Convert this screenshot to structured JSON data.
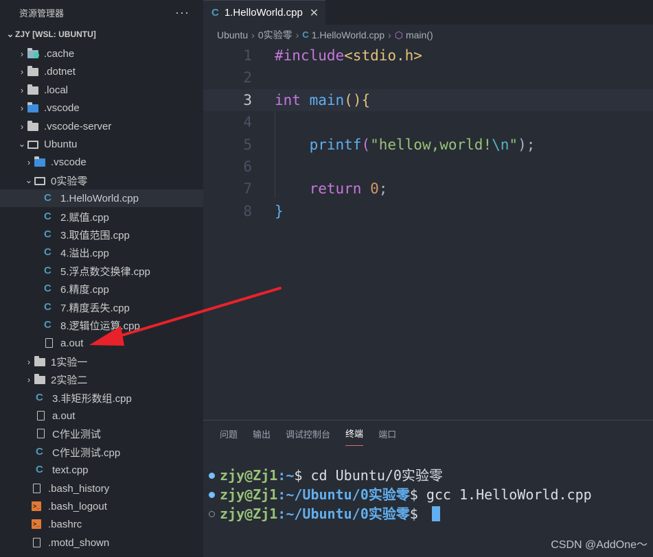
{
  "sidebar": {
    "title": "资源管理器",
    "more": "···",
    "root_label": "ZJY [WSL: UBUNTU]",
    "items": [
      {
        "label": ".cache",
        "icon": "cache-folder-icon"
      },
      {
        "label": ".dotnet",
        "icon": "folder-icon"
      },
      {
        "label": ".local",
        "icon": "folder-icon"
      },
      {
        "label": ".vscode",
        "icon": "vscode-folder-icon"
      },
      {
        "label": ".vscode-server",
        "icon": "folder-icon"
      },
      {
        "label": "Ubuntu",
        "icon": "folder-open-icon"
      },
      {
        "label": ".vscode",
        "icon": "vscode-folder-icon"
      },
      {
        "label": "0实验零",
        "icon": "folder-open-icon"
      },
      {
        "label": "1.HelloWorld.cpp",
        "icon": "cpp-file-icon"
      },
      {
        "label": "2.赋值.cpp",
        "icon": "cpp-file-icon"
      },
      {
        "label": "3.取值范围.cpp",
        "icon": "cpp-file-icon"
      },
      {
        "label": "4.溢出.cpp",
        "icon": "cpp-file-icon"
      },
      {
        "label": "5.浮点数交换律.cpp",
        "icon": "cpp-file-icon"
      },
      {
        "label": "6.精度.cpp",
        "icon": "cpp-file-icon"
      },
      {
        "label": "7.精度丢失.cpp",
        "icon": "cpp-file-icon"
      },
      {
        "label": "8.逻辑位运算.cpp",
        "icon": "cpp-file-icon"
      },
      {
        "label": "a.out",
        "icon": "file-icon"
      },
      {
        "label": "1实验一",
        "icon": "folder-icon"
      },
      {
        "label": "2实验二",
        "icon": "folder-icon"
      },
      {
        "label": "3.非矩形数组.cpp",
        "icon": "cpp-file-icon"
      },
      {
        "label": "a.out",
        "icon": "file-icon"
      },
      {
        "label": "C作业测试",
        "icon": "file-icon"
      },
      {
        "label": "C作业测试.cpp",
        "icon": "cpp-file-icon"
      },
      {
        "label": "text.cpp",
        "icon": "cpp-file-icon"
      },
      {
        "label": ".bash_history",
        "icon": "file-icon"
      },
      {
        "label": ".bash_logout",
        "icon": "shell-file-icon"
      },
      {
        "label": ".bashrc",
        "icon": "shell-file-icon"
      },
      {
        "label": ".motd_shown",
        "icon": "file-icon"
      }
    ]
  },
  "editor": {
    "tab_label": "1.HelloWorld.cpp",
    "breadcrumb": [
      "Ubuntu",
      "0实验零",
      "1.HelloWorld.cpp",
      "main()"
    ],
    "line_numbers": [
      "1",
      "2",
      "3",
      "4",
      "5",
      "6",
      "7",
      "8"
    ],
    "code": {
      "l1_pp": "#include",
      "l1_inc": "<stdio.h>",
      "l3_kw": "int",
      "l3_fn": "main",
      "l3_rest": "(){",
      "l5_fn": "printf",
      "l5_open": "(",
      "l5_str1": "\"hellow,world!",
      "l5_esc": "\\n",
      "l5_str2": "\"",
      "l5_close": ");",
      "l7_kw": "return",
      "l7_num": "0",
      "l7_semi": ";",
      "l8": "}"
    }
  },
  "panel": {
    "tabs": [
      "问题",
      "输出",
      "调试控制台",
      "终端",
      "端口"
    ],
    "active_tab": "终端",
    "terminal": {
      "lines": [
        {
          "user": "zjy@Zj1",
          "path": ":~",
          "prompt": "$ ",
          "cmd": "cd Ubuntu/0实验零"
        },
        {
          "user": "zjy@Zj1",
          "path": ":~/Ubuntu/0实验零",
          "prompt": "$ ",
          "cmd": "gcc 1.HelloWorld.cpp"
        },
        {
          "user": "zjy@Zj1",
          "path": ":~/Ubuntu/0实验零",
          "prompt": "$ ",
          "cmd": ""
        }
      ]
    }
  },
  "watermark": "CSDN @AddOne～",
  "colors": {
    "annotation_arrow": "#e8222b",
    "cpp_icon": "#519aba",
    "sidebar_bg": "#21252b",
    "editor_bg": "#282c34"
  }
}
